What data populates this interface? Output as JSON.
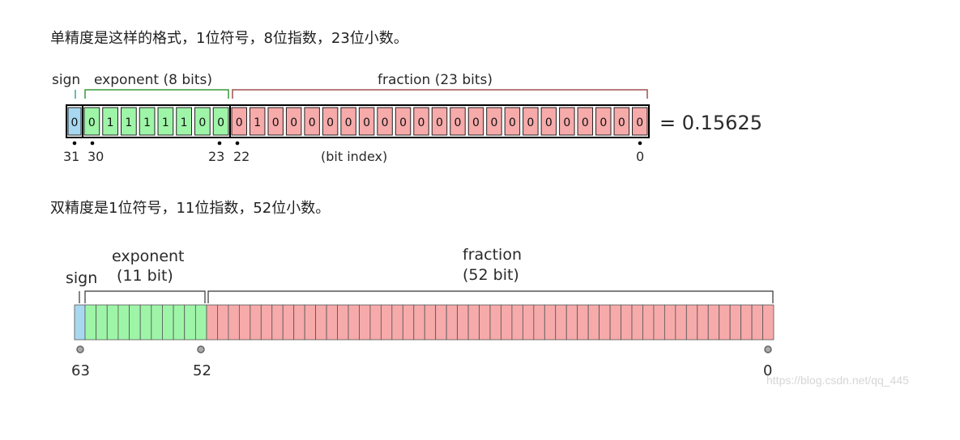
{
  "text": {
    "single_desc": "单精度是这样的格式，1位符号，8位指数，23位小数。",
    "double_desc": "双精度是1位符号，11位指数，52位小数。",
    "watermark": "https://blog.csdn.net/qq_445"
  },
  "single": {
    "sign_label": "sign",
    "exponent_label": "exponent (8 bits)",
    "fraction_label": "fraction (23 bits)",
    "bits": [
      "0",
      "0",
      "1",
      "1",
      "1",
      "1",
      "1",
      "0",
      "0",
      "0",
      "1",
      "0",
      "0",
      "0",
      "0",
      "0",
      "0",
      "0",
      "0",
      "0",
      "0",
      "0",
      "0",
      "0",
      "0",
      "0",
      "0",
      "0",
      "0",
      "0",
      "0",
      "0"
    ],
    "result": "= 0.15625",
    "index_31": "31",
    "index_30": "30",
    "index_23": "23",
    "index_22": "22",
    "index_0": "0",
    "bit_index_label": "(bit index)"
  },
  "double": {
    "sign_label": "sign",
    "exponent_label_line1": "exponent",
    "exponent_label_line2": "(11 bit)",
    "fraction_label_line1": "fraction",
    "fraction_label_line2": "(52 bit)",
    "index_63": "63",
    "index_52": "52",
    "index_0": "0"
  },
  "colors": {
    "sign": "#a8d8f0",
    "exponent": "#9ef5a8",
    "fraction": "#f7aaaa",
    "bracket_sign": "#3aa0a0",
    "bracket_exponent": "#3a9a3a",
    "bracket_fraction": "#a05050"
  }
}
